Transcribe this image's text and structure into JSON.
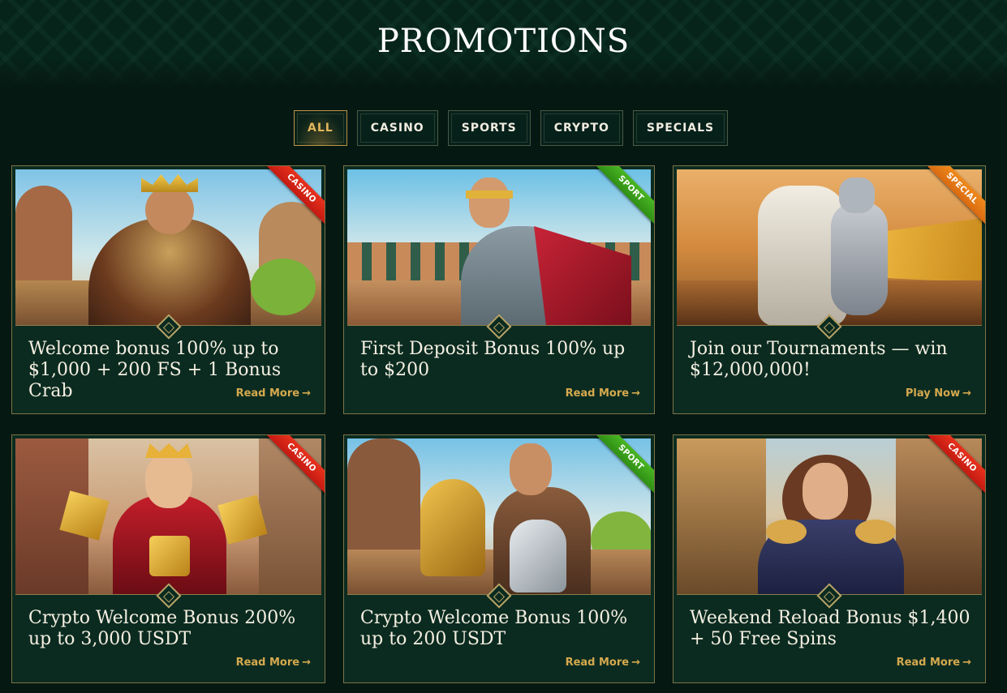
{
  "page": {
    "title": "PROMOTIONS"
  },
  "filters": [
    {
      "label": "ALL",
      "active": true
    },
    {
      "label": "CASINO",
      "active": false
    },
    {
      "label": "SPORTS",
      "active": false
    },
    {
      "label": "CRYPTO",
      "active": false
    },
    {
      "label": "SPECIALS",
      "active": false
    }
  ],
  "cards": [
    {
      "badge": "CASINO",
      "badge_type": "casino",
      "title": "Welcome bonus 100% up to $1,000 + 200 FS + 1 Bonus Crab",
      "link": "Read More",
      "image": "king-with-treasure"
    },
    {
      "badge": "SPORT",
      "badge_type": "sport",
      "title": "First Deposit Bonus 100% up to $200",
      "link": "Read More",
      "image": "gladiator-in-arena"
    },
    {
      "badge": "SPECIAL",
      "badge_type": "special",
      "title": "Join our Tournaments — win $12,000,000!",
      "link": "Play Now",
      "image": "knight-on-horse"
    },
    {
      "badge": "CASINO",
      "badge_type": "casino",
      "title": "Crypto Welcome Bonus 200% up to 3,000 USDT",
      "link": "Read More",
      "image": "queen-with-crypto-coins"
    },
    {
      "badge": "SPORT",
      "badge_type": "sport",
      "title": "Crypto Welcome Bonus 100% up to 200 USDT",
      "link": "Read More",
      "image": "champion-with-trophies"
    },
    {
      "badge": "CASINO",
      "badge_type": "casino",
      "title": "Weekend Reload Bonus $1,400 + 50 Free Spins",
      "link": "Read More",
      "image": "heroine-in-street"
    }
  ],
  "icons": {
    "link_arrow": "arrow-right-icon",
    "divider": "diamond-ornament-icon"
  },
  "colors": {
    "background": "#051812",
    "accent_gold": "#d5a94e",
    "casino": "#e8321d",
    "sport": "#49b623",
    "special": "#f08a1c"
  }
}
